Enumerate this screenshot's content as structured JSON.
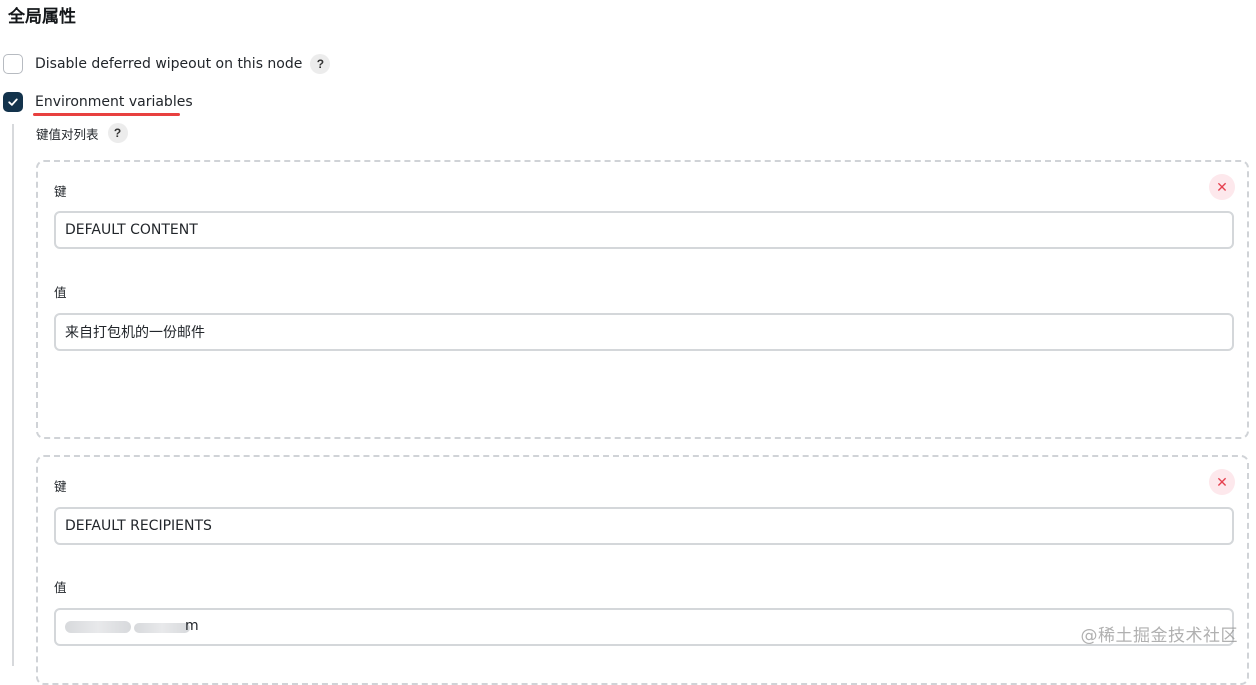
{
  "section": {
    "title": "全局属性"
  },
  "options": {
    "disable_wipeout": {
      "label": "Disable deferred wipeout on this node",
      "checked": false,
      "help": "?"
    },
    "env_vars": {
      "label": "Environment variables",
      "checked": true
    }
  },
  "env": {
    "list_label": "键值对列表",
    "help": "?",
    "entries": [
      {
        "key_label": "键",
        "key": "DEFAULT CONTENT",
        "value_label": "值",
        "value": "来自打包机的一份邮件",
        "delete": "✕"
      },
      {
        "key_label": "键",
        "key": "DEFAULT RECIPIENTS",
        "value_label": "值",
        "value": "m",
        "delete": "✕"
      }
    ]
  },
  "watermark": "@稀土掘金技术社区",
  "colors": {
    "accent": "#13334c",
    "annotation_underline": "#e8403f",
    "delete": "#e5414f"
  }
}
